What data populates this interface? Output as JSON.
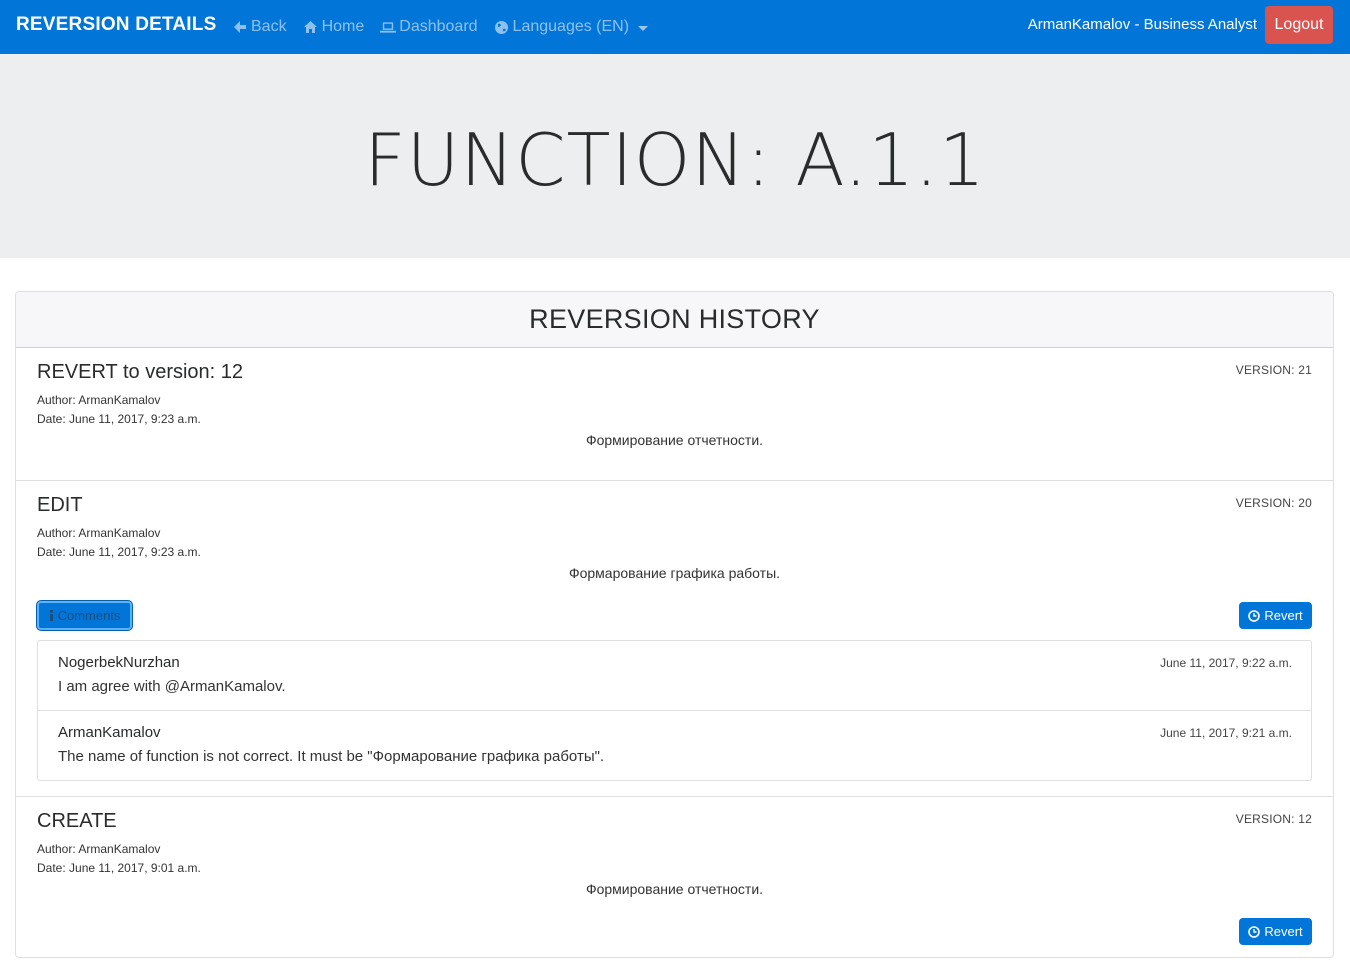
{
  "navbar": {
    "brand": "REVERSION DETAILS",
    "links": [
      {
        "label": "Back",
        "icon": "arrow-left-icon"
      },
      {
        "label": "Home",
        "icon": "home-icon"
      },
      {
        "label": "Dashboard",
        "icon": "laptop-icon"
      },
      {
        "label": "Languages (EN)",
        "icon": "globe-icon"
      }
    ],
    "user": "ArmanKamalov - Business Analyst",
    "logout": "Logout",
    "colors": {
      "bar": "#0275d8",
      "logout": "#d9534f"
    }
  },
  "jumbotron": {
    "title": "FUNCTION: A.1.1"
  },
  "history": {
    "title": "REVERSION HISTORY",
    "revisions": [
      {
        "title": "REVERT to version: 12",
        "version": "VERSION: 21",
        "author": "Author: ArmanKamalov",
        "date": "Date: June 11, 2017, 9:23 a.m.",
        "description": "Формирование отчетности."
      },
      {
        "title": "EDIT",
        "version": "VERSION: 20",
        "author": "Author: ArmanKamalov",
        "date": "Date: June 11, 2017, 9:23 a.m.",
        "description": "Формарование графика работы.",
        "comments_button": "Comments",
        "revert_button": "Revert",
        "comments": [
          {
            "author": "NogerbekNurzhan",
            "date": "June 11, 2017, 9:22 a.m.",
            "text": "I am agree with @ArmanKamalov."
          },
          {
            "author": "ArmanKamalov",
            "date": "June 11, 2017, 9:21 a.m.",
            "text": "The name of function is not correct. It must be \"Формарование графика работы\"."
          }
        ]
      },
      {
        "title": "CREATE",
        "version": "VERSION: 12",
        "author": "Author: ArmanKamalov",
        "date": "Date: June 11, 2017, 9:01 a.m.",
        "description": "Формирование отчетности.",
        "revert_button": "Revert"
      }
    ]
  }
}
